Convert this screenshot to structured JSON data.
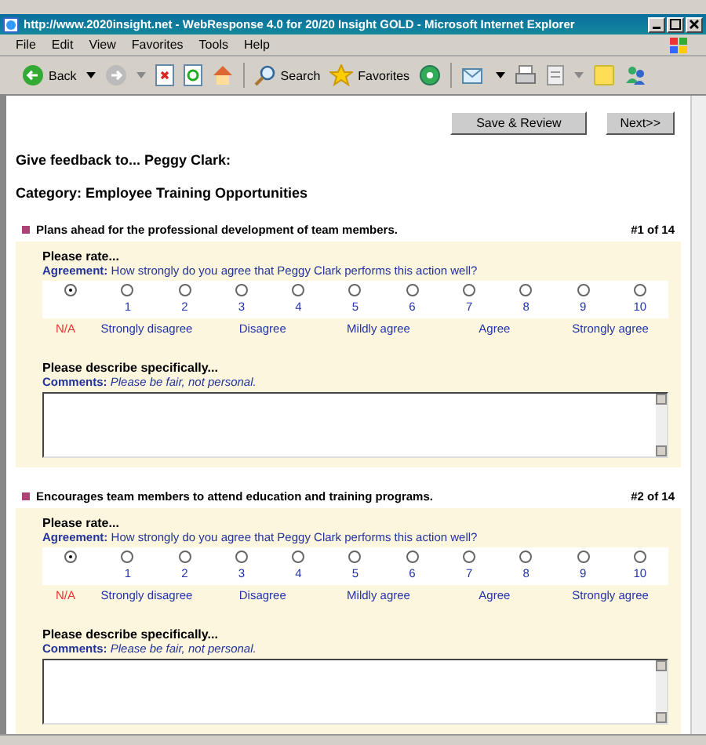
{
  "window": {
    "title": "http://www.2020insight.net - WebResponse 4.0 for 20/20 Insight GOLD - Microsoft Internet Explorer"
  },
  "menu": [
    "File",
    "Edit",
    "View",
    "Favorites",
    "Tools",
    "Help"
  ],
  "toolbar": {
    "back": "Back",
    "search": "Search",
    "favorites": "Favorites"
  },
  "buttons": [
    "Save & Review",
    "Next>>"
  ],
  "heading": "Give feedback to... Peggy Clark:",
  "category": "Category: Employee Training Opportunities",
  "questions": [
    {
      "title": "Plans ahead for the professional development of team members.",
      "number": "#1 of 14",
      "rate_prompt": "Please rate...",
      "scale_name": "Agreement:",
      "scale_question": "How strongly do you agree that Peggy Clark performs this action well?",
      "options": [
        {
          "selected": true
        },
        {
          "value": "1",
          "selected": false
        },
        {
          "value": "2",
          "selected": false
        },
        {
          "value": "3",
          "selected": false
        },
        {
          "value": "4",
          "selected": false
        },
        {
          "value": "5",
          "selected": false
        },
        {
          "value": "6",
          "selected": false
        },
        {
          "value": "7",
          "selected": false
        },
        {
          "value": "8",
          "selected": false
        },
        {
          "value": "9",
          "selected": false
        },
        {
          "value": "10",
          "selected": false
        }
      ],
      "scale_labels": [
        {
          "text": "N/A",
          "kind": "na"
        },
        {
          "text": "Strongly disagree",
          "kind": "range"
        },
        {
          "text": "Disagree",
          "kind": "range"
        },
        {
          "text": "Mildly agree",
          "kind": "range"
        },
        {
          "text": "Agree",
          "kind": "range"
        },
        {
          "text": "Strongly agree",
          "kind": "range"
        }
      ],
      "describe_prompt": "Please describe specifically...",
      "comments_label": "Comments:",
      "comments_hint": "Please be fair, not personal."
    },
    {
      "title": "Encourages team members to attend education and training programs.",
      "number": "#2 of 14",
      "rate_prompt": "Please rate...",
      "scale_name": "Agreement:",
      "scale_question": "How strongly do you agree that Peggy Clark performs this action well?",
      "options": [
        {
          "selected": true
        },
        {
          "value": "1",
          "selected": false
        },
        {
          "value": "2",
          "selected": false
        },
        {
          "value": "3",
          "selected": false
        },
        {
          "value": "4",
          "selected": false
        },
        {
          "value": "5",
          "selected": false
        },
        {
          "value": "6",
          "selected": false
        },
        {
          "value": "7",
          "selected": false
        },
        {
          "value": "8",
          "selected": false
        },
        {
          "value": "9",
          "selected": false
        },
        {
          "value": "10",
          "selected": false
        }
      ],
      "scale_labels": [
        {
          "text": "N/A",
          "kind": "na"
        },
        {
          "text": "Strongly disagree",
          "kind": "range"
        },
        {
          "text": "Disagree",
          "kind": "range"
        },
        {
          "text": "Mildly agree",
          "kind": "range"
        },
        {
          "text": "Agree",
          "kind": "range"
        },
        {
          "text": "Strongly agree",
          "kind": "range"
        }
      ],
      "describe_prompt": "Please describe specifically...",
      "comments_label": "Comments:",
      "comments_hint": "Please be fair, not personal."
    }
  ]
}
